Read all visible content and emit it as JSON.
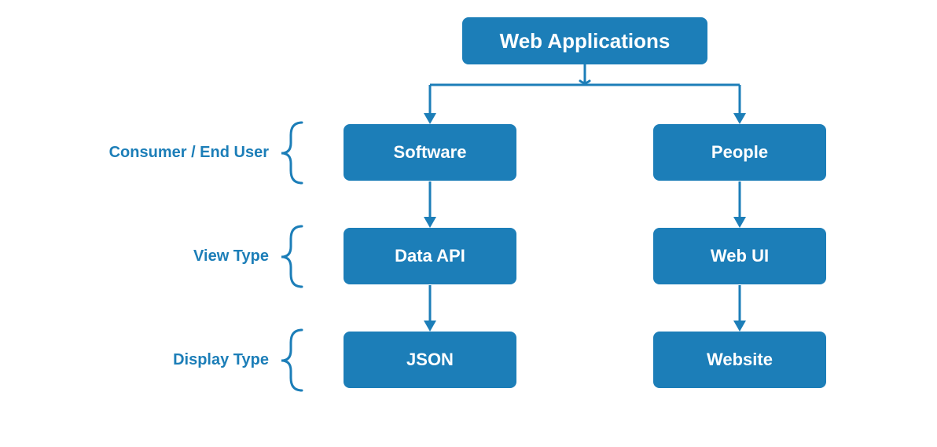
{
  "diagram": {
    "root": "Web Applications",
    "rows": [
      {
        "label": "Consumer / End User",
        "left": "Software",
        "right": "People"
      },
      {
        "label": "View Type",
        "left": "Data API",
        "right": "Web UI"
      },
      {
        "label": "Display Type",
        "left": "JSON",
        "right": "Website"
      }
    ],
    "colors": {
      "primary": "#1c7eb8",
      "text_on_primary": "#ffffff"
    }
  }
}
